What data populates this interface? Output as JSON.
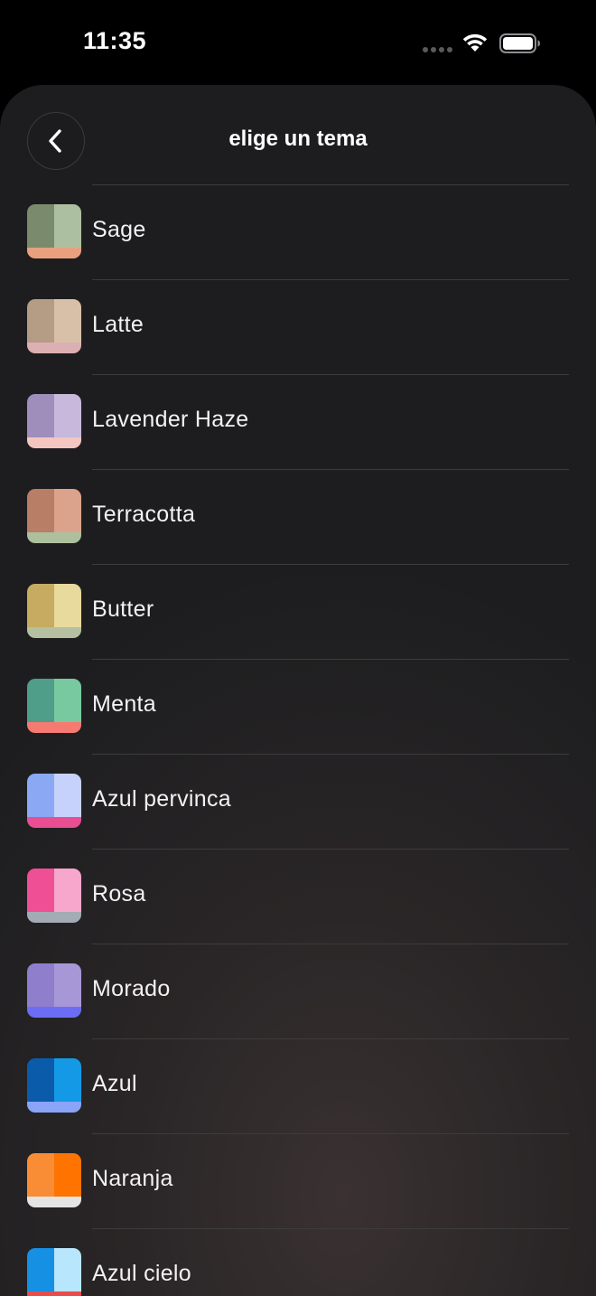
{
  "status_bar": {
    "time": "11:35"
  },
  "header": {
    "title": "elige un tema",
    "back_icon": "chevron-left-icon"
  },
  "themes": [
    {
      "name": "Sage",
      "colors": {
        "left": "#7a8a6c",
        "right": "#adbfa1",
        "strip": "#e8a07f"
      }
    },
    {
      "name": "Latte",
      "colors": {
        "left": "#b59c85",
        "right": "#d8c0a8",
        "strip": "#dcb0b2"
      }
    },
    {
      "name": "Lavender Haze",
      "colors": {
        "left": "#9f8dbb",
        "right": "#c7b8dc",
        "strip": "#f4c6c0"
      }
    },
    {
      "name": "Terracotta",
      "colors": {
        "left": "#b87e66",
        "right": "#dba38b",
        "strip": "#aebf9e"
      }
    },
    {
      "name": "Butter",
      "colors": {
        "left": "#c7ab61",
        "right": "#e8d99c",
        "strip": "#b4c09f"
      }
    },
    {
      "name": "Menta",
      "colors": {
        "left": "#4e9e8a",
        "right": "#79c9a0",
        "strip": "#f57a72"
      }
    },
    {
      "name": "Azul pervinca",
      "colors": {
        "left": "#8aa8f3",
        "right": "#c6d2fb",
        "strip": "#e94e93"
      }
    },
    {
      "name": "Rosa",
      "colors": {
        "left": "#ef4f94",
        "right": "#f7a6cc",
        "strip": "#a3abb4"
      }
    },
    {
      "name": "Morado",
      "colors": {
        "left": "#8e7ecb",
        "right": "#a897d6",
        "strip": "#6b6ef4"
      }
    },
    {
      "name": "Azul",
      "colors": {
        "left": "#0a5caa",
        "right": "#1499e6",
        "strip": "#8aa4f7"
      }
    },
    {
      "name": "Naranja",
      "colors": {
        "left": "#f98d36",
        "right": "#ff7300",
        "strip": "#e4e4e4"
      }
    },
    {
      "name": "Azul cielo",
      "colors": {
        "left": "#1690e3",
        "right": "#b8e6fc",
        "strip": "#e94c4c"
      }
    }
  ]
}
